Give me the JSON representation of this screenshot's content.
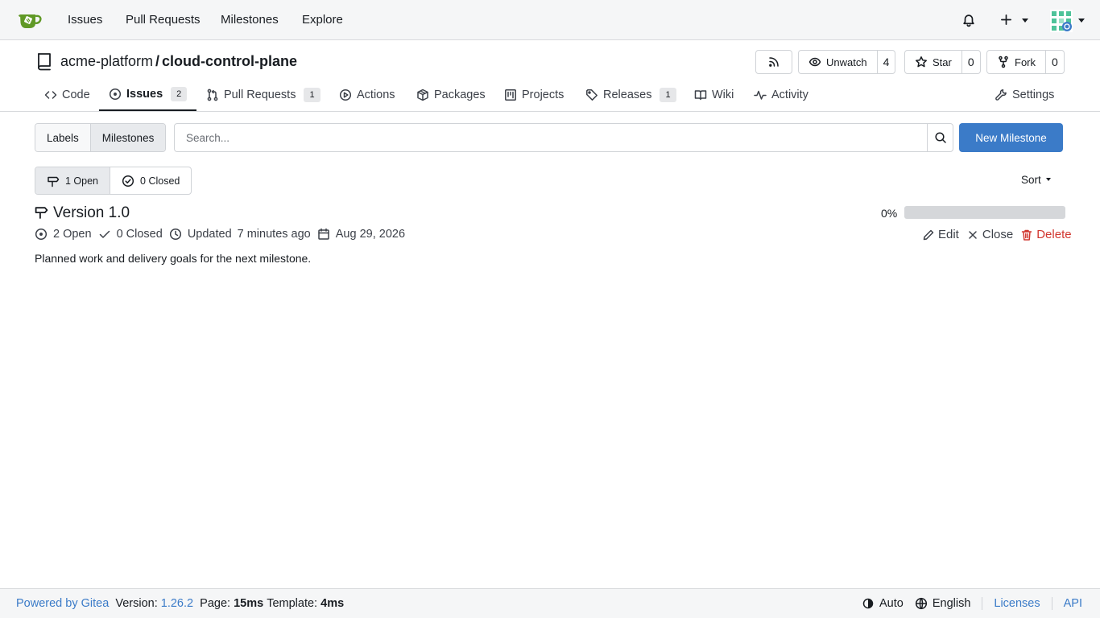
{
  "topnav": {
    "items": [
      "Issues",
      "Pull Requests",
      "Milestones",
      "Explore"
    ]
  },
  "repo": {
    "owner": "acme-platform",
    "separator": "/",
    "name": "cloud-control-plane",
    "unwatch_label": "Unwatch",
    "watch_count": "4",
    "star_label": "Star",
    "star_count": "0",
    "fork_label": "Fork",
    "fork_count": "0"
  },
  "tabs": [
    {
      "label": "Code",
      "icon": "code-icon"
    },
    {
      "label": "Issues",
      "icon": "issue-opened-icon",
      "badge": "2",
      "active": true
    },
    {
      "label": "Pull Requests",
      "icon": "git-pull-request-icon",
      "badge": "1"
    },
    {
      "label": "Actions",
      "icon": "play-icon"
    },
    {
      "label": "Packages",
      "icon": "package-icon"
    },
    {
      "label": "Projects",
      "icon": "project-icon"
    },
    {
      "label": "Releases",
      "icon": "tag-icon",
      "badge": "1"
    },
    {
      "label": "Wiki",
      "icon": "book-icon"
    },
    {
      "label": "Activity",
      "icon": "pulse-icon"
    },
    {
      "label": "Settings",
      "icon": "tools-icon"
    }
  ],
  "filters": {
    "labels_label": "Labels",
    "milestones_label": "Milestones",
    "search_placeholder": "Search...",
    "new_milestone_label": "New Milestone",
    "open_label": "1 Open",
    "closed_label": "0 Closed",
    "sort_label": "Sort"
  },
  "milestone": {
    "title": "Version 1.0",
    "percent_label": "0%",
    "progress": 0,
    "open_label": "2 Open",
    "closed_label": "0 Closed",
    "updated_label": "Updated",
    "updated_time": "7 minutes ago",
    "due_date": "Aug 29, 2026",
    "edit_label": "Edit",
    "close_label": "Close",
    "delete_label": "Delete",
    "description": "Planned work and delivery goals for the next milestone."
  },
  "footer": {
    "powered_by": "Powered by Gitea",
    "version_label": "Version:",
    "version": "1.26.2",
    "page_label": "Page:",
    "page_time": "15ms",
    "template_label": "Template:",
    "template_time": "4ms",
    "theme_label": "Auto",
    "language_label": "English",
    "licenses_label": "Licenses",
    "api_label": "API"
  },
  "colors": {
    "accent": "#3b7bc8",
    "danger": "#d1362f",
    "logo_green": "#609926"
  }
}
